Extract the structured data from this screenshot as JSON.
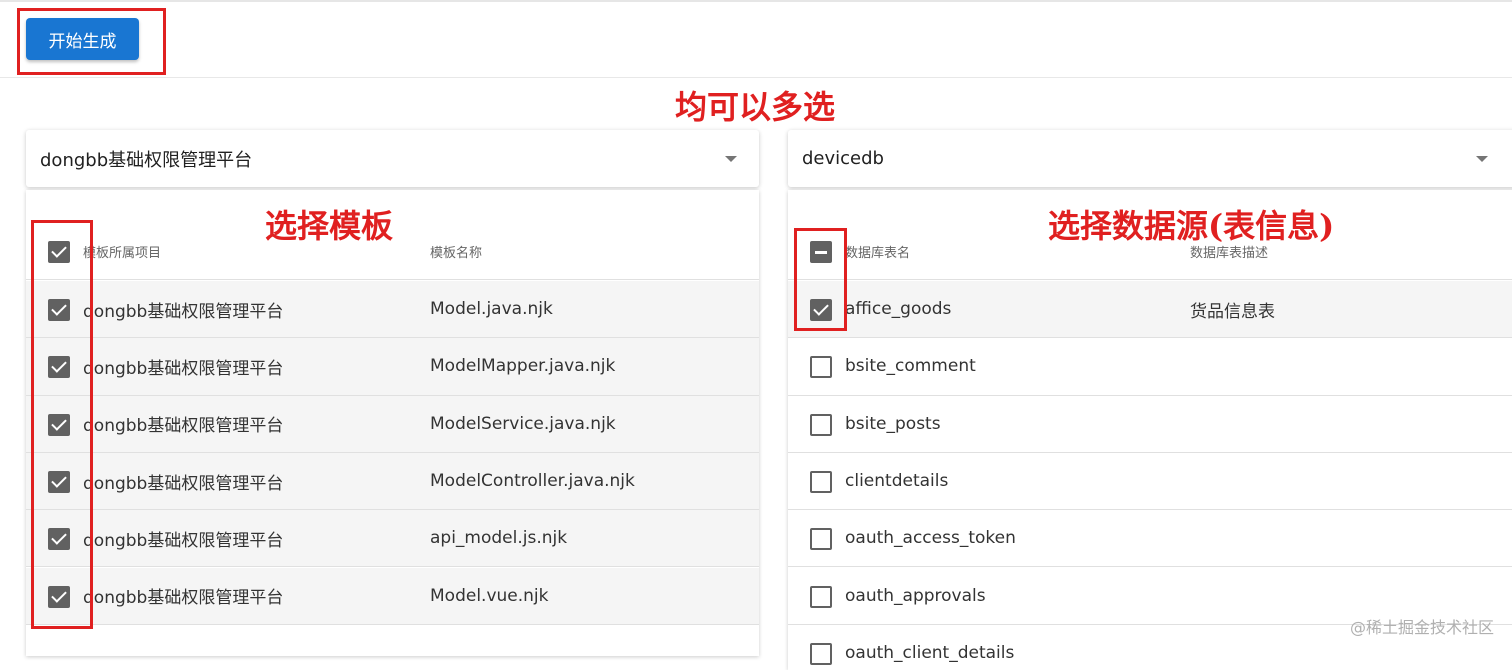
{
  "toolbar": {
    "generate_label": "开始生成"
  },
  "annotations": {
    "multi_select": "均可以多选",
    "choose_template": "选择模板",
    "choose_datasource": "选择数据源(表信息)",
    "color": "#e02020"
  },
  "left": {
    "select_value": "dongbb基础权限管理平台",
    "headers": [
      "模板所属项目",
      "模板名称"
    ],
    "header_checkbox": "checked",
    "rows": [
      {
        "checked": true,
        "project": "dongbb基础权限管理平台",
        "name": "Model.java.njk"
      },
      {
        "checked": true,
        "project": "dongbb基础权限管理平台",
        "name": "ModelMapper.java.njk"
      },
      {
        "checked": true,
        "project": "dongbb基础权限管理平台",
        "name": "ModelService.java.njk"
      },
      {
        "checked": true,
        "project": "dongbb基础权限管理平台",
        "name": "ModelController.java.njk"
      },
      {
        "checked": true,
        "project": "dongbb基础权限管理平台",
        "name": "api_model.js.njk"
      },
      {
        "checked": true,
        "project": "dongbb基础权限管理平台",
        "name": "Model.vue.njk"
      }
    ]
  },
  "right": {
    "select_value": "devicedb",
    "headers": [
      "数据库表名",
      "数据库表描述"
    ],
    "header_checkbox": "indeterminate",
    "rows": [
      {
        "checked": true,
        "table": "affice_goods",
        "desc": "货品信息表"
      },
      {
        "checked": false,
        "table": "bsite_comment",
        "desc": ""
      },
      {
        "checked": false,
        "table": "bsite_posts",
        "desc": ""
      },
      {
        "checked": false,
        "table": "clientdetails",
        "desc": ""
      },
      {
        "checked": false,
        "table": "oauth_access_token",
        "desc": ""
      },
      {
        "checked": false,
        "table": "oauth_approvals",
        "desc": ""
      },
      {
        "checked": false,
        "table": "oauth_client_details",
        "desc": ""
      }
    ]
  },
  "watermark": "@稀土掘金技术社区",
  "colors": {
    "primary": "#1976d2",
    "checkbox": "#616161"
  }
}
